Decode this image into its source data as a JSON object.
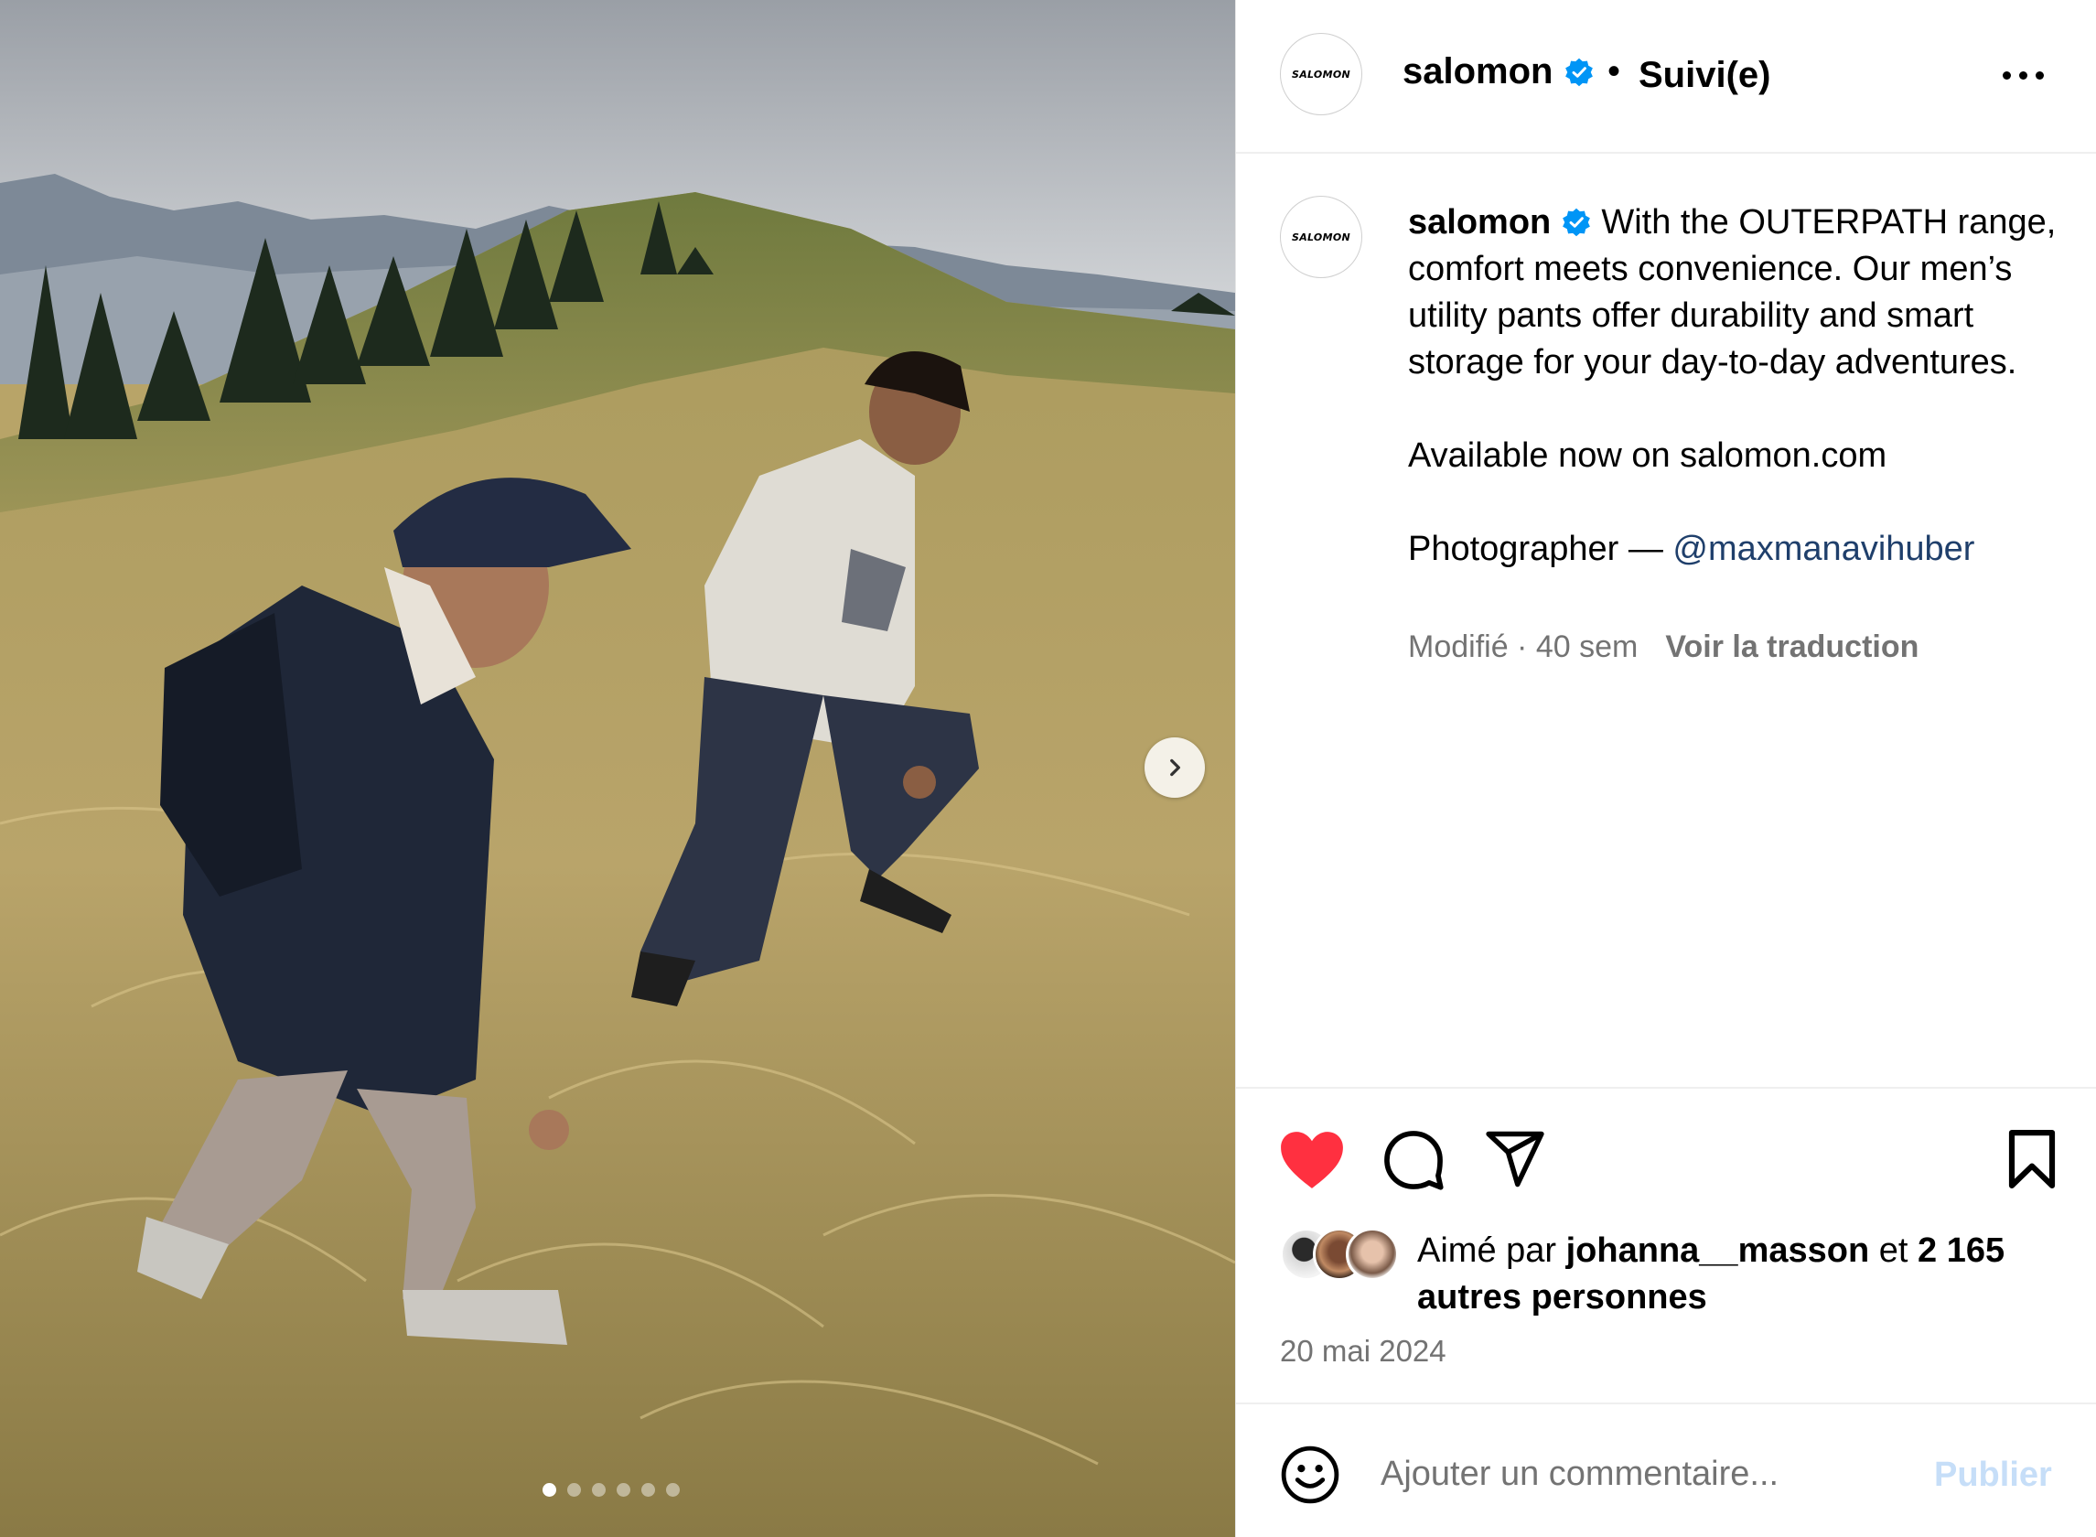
{
  "post": {
    "account": {
      "username": "salomon",
      "logo_text": "SALOMON",
      "verified": true,
      "follow_status": "Suivi(e)",
      "separator": "•"
    },
    "caption": {
      "username": "salomon",
      "lines": [
        "With the OUTERPATH range, comfort meets convenience. Our men’s utility pants offer durability and smart storage for your day-to-day adventures."
      ],
      "availability": "Available now on salomon.com",
      "credit_prefix": "Photographer — ",
      "credit_mention": "@maxmanavihuber"
    },
    "meta": {
      "edited_time": "Modifié · 40 sem",
      "translate_label": "Voir la traduction"
    },
    "likes": {
      "prefix": "Aimé par ",
      "user": "johanna__masson",
      "middle": " et ",
      "others": "2 165 autres personnes"
    },
    "date": "20 mai 2024",
    "comment": {
      "placeholder": "Ajouter un commentaire...",
      "publish_label": "Publier"
    },
    "carousel": {
      "total_slides": 6,
      "active_index": 0
    },
    "icons": {
      "more": "more-horizontal-icon",
      "like": "heart-filled-icon",
      "comment": "comment-bubble-icon",
      "share": "paper-plane-icon",
      "save": "bookmark-icon",
      "emoji": "smiley-icon",
      "next": "chevron-right-icon"
    },
    "colors": {
      "like_red": "#ff3040",
      "verified_blue": "#0095f6",
      "mention_blue": "#1f3f6b",
      "publish_disabled": "#c6def8",
      "secondary_text": "#737373"
    }
  }
}
